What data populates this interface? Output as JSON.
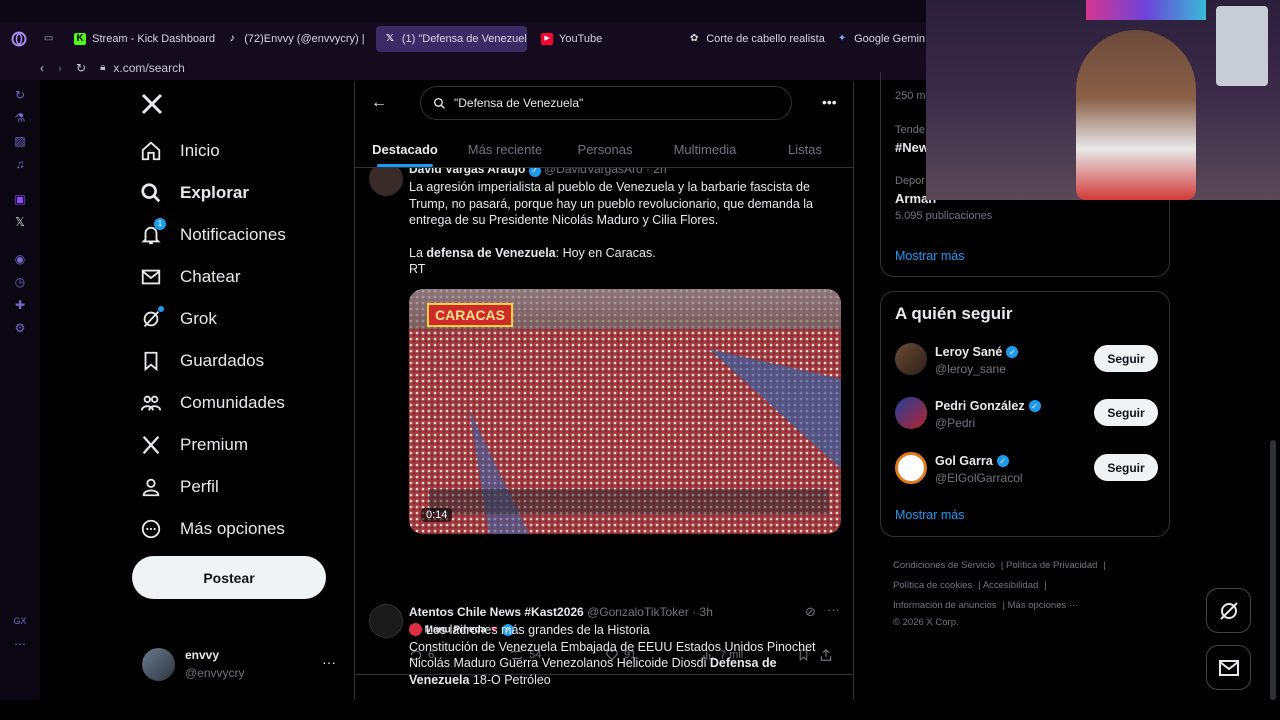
{
  "browser": {
    "tabs": [
      {
        "label": "Stream - Kick Dashboard",
        "icon": "kick-icon"
      },
      {
        "label": "(72)Envvy (@envvycry) |",
        "icon": "tiktok-icon"
      },
      {
        "label": "(1) \"Defensa de Venezuela",
        "icon": "x-icon",
        "active": true
      },
      {
        "label": "YouTube",
        "icon": "youtube-icon"
      },
      {
        "label": "Corte de cabello realista",
        "icon": "openai-icon"
      },
      {
        "label": "Google Gemin",
        "icon": "gemini-icon"
      }
    ],
    "url": "x.com/search"
  },
  "sidebar": {
    "items": [
      {
        "label": "Inicio",
        "icon": "home-icon"
      },
      {
        "label": "Explorar",
        "icon": "search-icon",
        "active": true
      },
      {
        "label": "Notificaciones",
        "icon": "bell-icon",
        "badge": "1"
      },
      {
        "label": "Chatear",
        "icon": "mail-icon"
      },
      {
        "label": "Grok",
        "icon": "grok-icon"
      },
      {
        "label": "Guardados",
        "icon": "bookmark-icon"
      },
      {
        "label": "Comunidades",
        "icon": "people-icon"
      },
      {
        "label": "Premium",
        "icon": "x-icon"
      },
      {
        "label": "Perfil",
        "icon": "person-icon"
      },
      {
        "label": "Más opciones",
        "icon": "more-circle-icon"
      }
    ],
    "post_label": "Postear",
    "account": {
      "name": "envvy",
      "handle": "@envvycry"
    }
  },
  "search": {
    "query": "\"Defensa de Venezuela\"",
    "tabs": [
      "Destacado",
      "Más reciente",
      "Personas",
      "Multimedia",
      "Listas"
    ]
  },
  "tweet1": {
    "author": "David Vargas Araujo",
    "handle": "@DavidVargasAro · 2h",
    "text1": "La agresión imperialista al pueblo de Venezuela y la barbarie fascista de Trump, no pasará, porque hay un pueblo revolucionario, que demanda la entrega de su Presidente Nicolás Maduro y Cilia Flores.",
    "text2_pre": "La ",
    "text2_bold": "defensa de Venezuela",
    "text2_post": ": Hoy en Caracas.",
    "text3": "RT",
    "media_tag": "CARACAS",
    "media_time": "0:14",
    "source_prefix": "De ",
    "source_name": "Manu Pineda",
    "replies": "6",
    "reposts": "54",
    "likes": "91",
    "views": "7 mil"
  },
  "tweet2": {
    "author": "Atentos Chile News #Kast2026",
    "handle": "@GonzaloTikToker · 3h",
    "line1": "Los ladrones más grandes de la Historia",
    "line2": "Constitución de Venezuela Embajada de EEUU Estados Unidos Pinochet Nicolás Maduro Guerra Venezolanos Helicoide Diosdi ",
    "line2_bold": "Defensa de Venezuela",
    "line3": " 18-O Petróleo"
  },
  "trends": {
    "t1_count": "250 m",
    "t2_small": "Tende",
    "t2_big": "#New",
    "t3_small": "Depor",
    "t3_big": "Arman",
    "t3_count": "5.095 publicaciones",
    "show_more": "Mostrar más"
  },
  "who_to_follow": {
    "title": "A quién seguir",
    "users": [
      {
        "name": "Leroy Sané",
        "handle": "@leroy_sane",
        "button": "Seguir"
      },
      {
        "name": "Pedri González",
        "handle": "@Pedri",
        "button": "Seguir"
      },
      {
        "name": "Gol Garra",
        "handle": "@ElGolGarracol",
        "button": "Seguir"
      }
    ],
    "show_more": "Mostrar más"
  },
  "footer": {
    "links": [
      "Condiciones de Servicio",
      "Política de Privacidad",
      "Política de cookies",
      "Accesibilidad",
      "Información de anuncios",
      "Más opciones ···"
    ],
    "copyright": "© 2026 X Corp."
  },
  "colors": {
    "accent": "#1d9bf0",
    "browser_active_tab": "#3a2a66",
    "background": "#000000"
  }
}
